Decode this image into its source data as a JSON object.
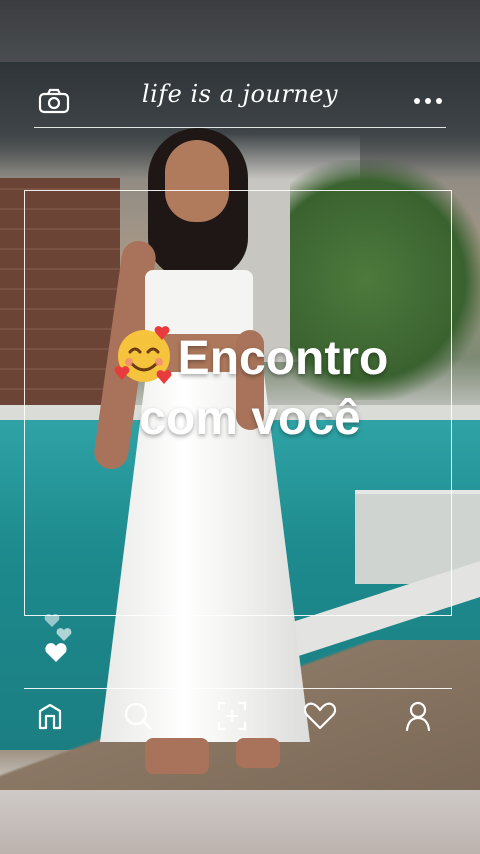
{
  "header": {
    "brand_text": "life is a journey",
    "camera_icon": "camera-icon",
    "more_icon": "more-dots-icon"
  },
  "caption": {
    "emoji": "smiling-face-with-hearts-emoji",
    "line1": "Encontro",
    "line2": "com você"
  },
  "reactions": {
    "icon": "floating-hearts-icon"
  },
  "bottom_nav": {
    "items": [
      {
        "icon": "home-icon"
      },
      {
        "icon": "search-icon"
      },
      {
        "icon": "add-post-icon"
      },
      {
        "icon": "heart-icon"
      },
      {
        "icon": "profile-icon"
      }
    ]
  },
  "colors": {
    "overlay_line": "#ffffff",
    "pool": "#1d8a8d"
  }
}
